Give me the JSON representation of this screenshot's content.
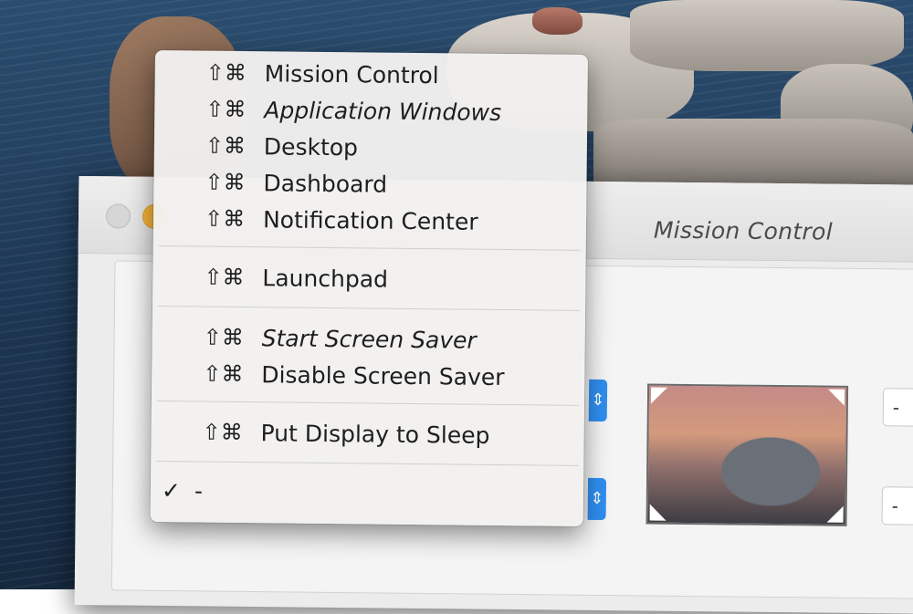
{
  "window": {
    "title": "Mission Control"
  },
  "menu": {
    "modifier_glyphs": "⇧⌘",
    "groups": [
      [
        {
          "label": "Mission Control",
          "alternate": false
        },
        {
          "label": "Application Windows",
          "alternate": true
        },
        {
          "label": "Desktop",
          "alternate": false
        },
        {
          "label": "Dashboard",
          "alternate": false
        },
        {
          "label": "Notification Center",
          "alternate": false
        }
      ],
      [
        {
          "label": "Launchpad",
          "alternate": false
        }
      ],
      [
        {
          "label": "Start Screen Saver",
          "alternate": true
        },
        {
          "label": "Disable Screen Saver",
          "alternate": false
        }
      ],
      [
        {
          "label": "Put Display to Sleep",
          "alternate": false
        }
      ]
    ],
    "checked_item": {
      "check": "✓",
      "label": "-"
    }
  },
  "pane": {
    "select_arrow": "⌃⌄",
    "right_select_top": "-",
    "right_select_bottom": "-"
  },
  "colors": {
    "accent": "#2f8ef0",
    "minimize": "#f5b33a"
  }
}
